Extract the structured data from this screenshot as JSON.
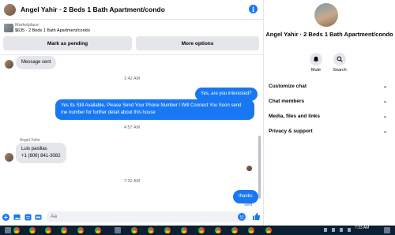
{
  "header": {
    "title": "Angel Yahir · 2 Beds 1 Bath Apartment/condo",
    "info_icon": "info-icon"
  },
  "marketplace": {
    "label": "Marketplace",
    "item": "$635 · 2 Beds 1 Bath Apartment/condo",
    "mark_pending_label": "Mark as pending",
    "more_options_label": "More options"
  },
  "messages": [
    {
      "direction": "in",
      "text": "Message sent"
    },
    {
      "type": "timestamp",
      "text": "1:42 AM"
    },
    {
      "direction": "out",
      "text": "Yes, are you interested?"
    },
    {
      "direction": "out",
      "text": "Yes Its Still Available, Please Send Your Phone Number I Will Connect You Soon send me number for further detail about this house"
    },
    {
      "type": "timestamp",
      "text": "4:57 AM"
    },
    {
      "sender": "Angel Yahir",
      "direction": "in",
      "text_line1": "Luis pasillas",
      "text_line2": "+1 (806) 841-3082"
    },
    {
      "type": "timestamp",
      "text": "7:32 AM"
    },
    {
      "direction": "out",
      "text": "thanks",
      "status": "Sent"
    }
  ],
  "composer": {
    "placeholder": "Aa",
    "icons": [
      "plus-circle-icon",
      "image-icon",
      "sticker-icon",
      "gif-icon",
      "emoji-icon",
      "thumbs-up-icon"
    ]
  },
  "sidebar": {
    "name": "Angel Yahir · 2 Beds 1 Bath Apartment/condo",
    "actions": [
      {
        "label": "Mute",
        "icon": "bell-icon"
      },
      {
        "label": "Search",
        "icon": "search-icon"
      }
    ],
    "sections": [
      {
        "label": "Customize chat"
      },
      {
        "label": "Chat members"
      },
      {
        "label": "Media, files and links"
      },
      {
        "label": "Privacy & support"
      }
    ]
  },
  "taskbar": {
    "time": "7:33 AM"
  },
  "colors": {
    "accent": "#1877f2",
    "bubble_in": "#e4e6eb",
    "taskbar": "#0c1f33"
  }
}
